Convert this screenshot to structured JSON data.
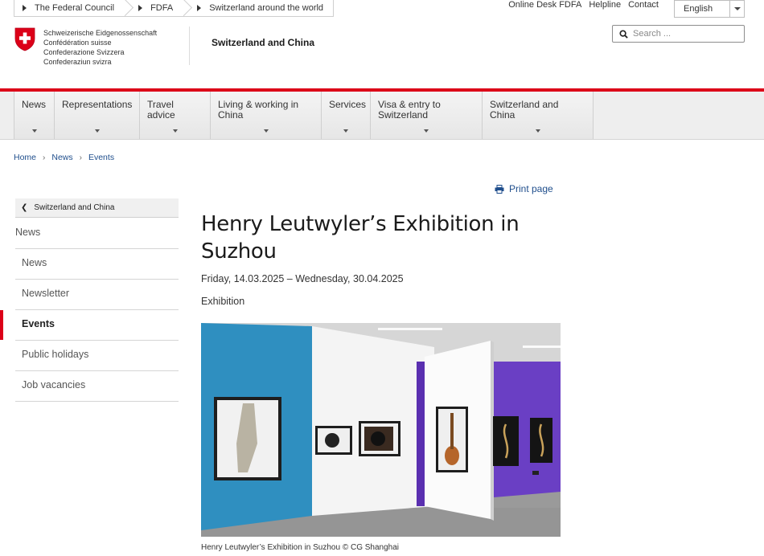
{
  "top_tabs": [
    "The Federal Council",
    "FDFA",
    "Switzerland around the world"
  ],
  "service_links": [
    "Online Desk FDFA",
    "Helpline",
    "Contact"
  ],
  "language": "English",
  "search_placeholder": "Search ...",
  "confederation_lines": [
    "Schweizerische Eidgenossenschaft",
    "Confédération suisse",
    "Confederazione Svizzera",
    "Confederaziun svizra"
  ],
  "site_title": "Switzerland and China",
  "main_nav": [
    {
      "label": "News"
    },
    {
      "label": "Representations"
    },
    {
      "label": "Travel advice"
    },
    {
      "label": "Living & working in China"
    },
    {
      "label": "Services"
    },
    {
      "label": "Visa & entry to Switzerland"
    },
    {
      "label": "Switzerland and China"
    }
  ],
  "breadcrumb": [
    "Home",
    "News",
    "Events"
  ],
  "print_label": "Print page",
  "sidebar": {
    "back_label": "Switzerland and China",
    "section": "News",
    "items": [
      "News",
      "Newsletter",
      "Events",
      "Public holidays",
      "Job vacancies"
    ],
    "active": "Events"
  },
  "article": {
    "title": "Henry Leutwyler’s Exhibition in Suzhou",
    "date": "Friday, 14.03.2025 – Wednesday, 30.04.2025",
    "category": "Exhibition",
    "caption": "Henry Leutwyler’s Exhibition in Suzhou © CG Shanghai"
  },
  "colors": {
    "accent_red": "#dc0018",
    "link_blue": "#1f4e8c",
    "nav_bg": "#eeeeee"
  }
}
